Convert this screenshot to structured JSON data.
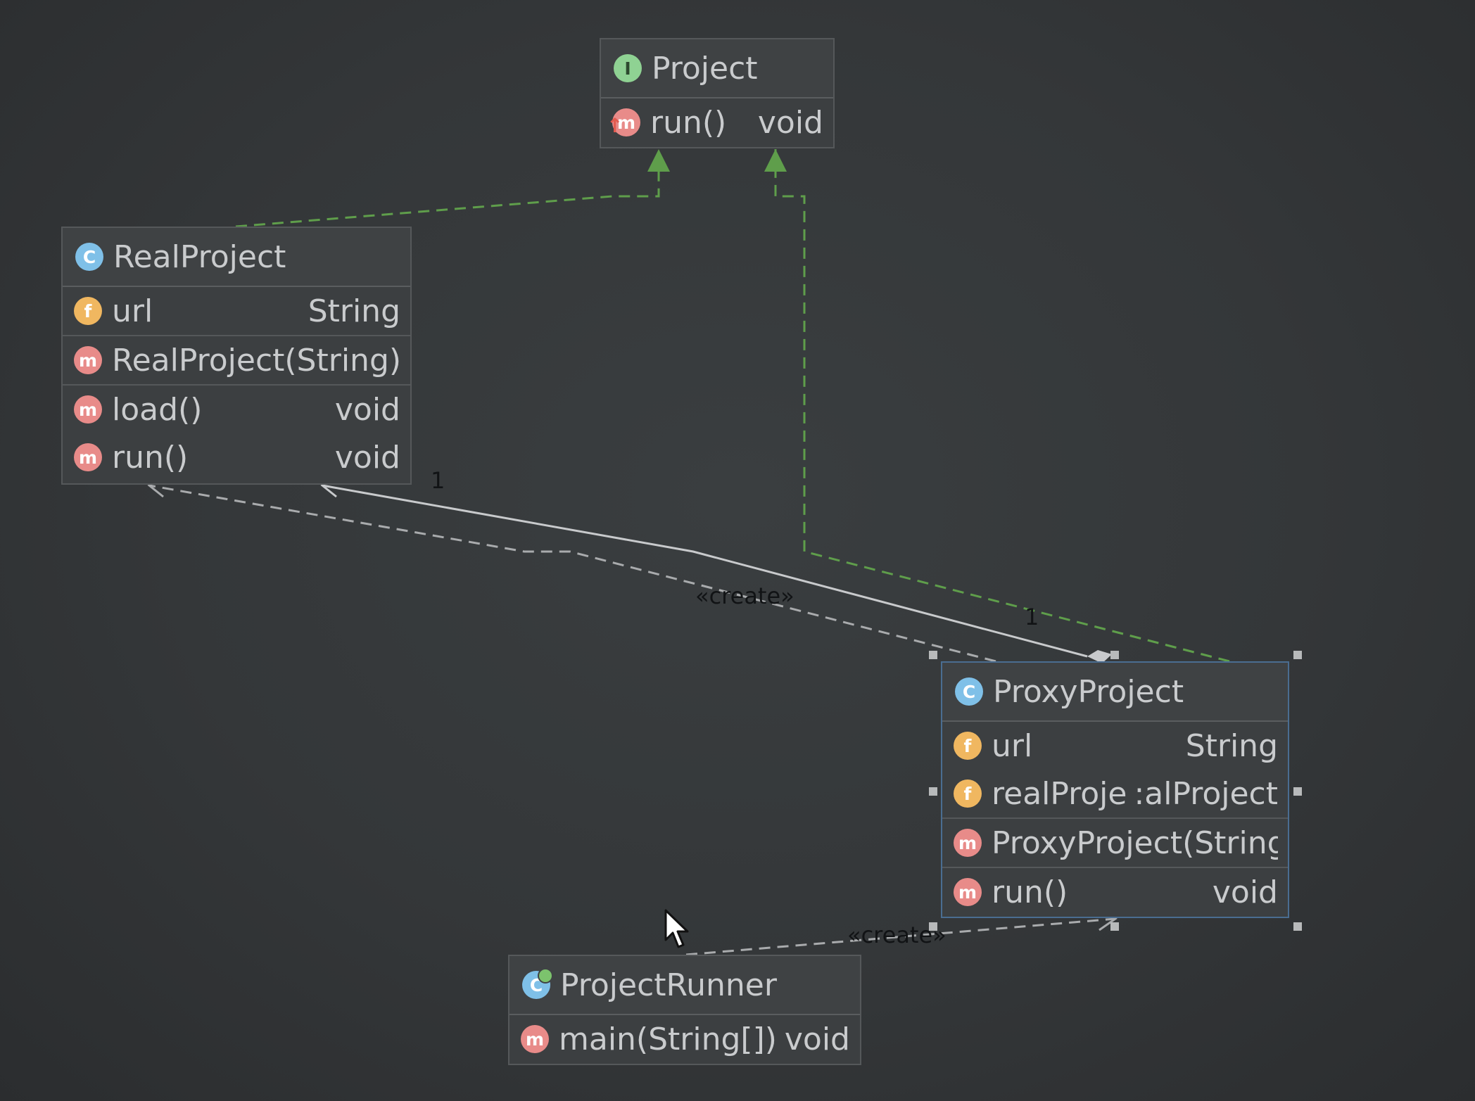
{
  "colors": {
    "realization_edge": "#5f9e4b",
    "dependency_edge": "#a9abad",
    "association_edge": "#c8cacc",
    "selection_border": "#4a6d91"
  },
  "nodes": {
    "project": {
      "kind": "interface",
      "icon": "interface-icon",
      "icon_letter": "I",
      "name": "Project",
      "methods": [
        {
          "name": "run()",
          "type": "void",
          "icon_letter": "m"
        }
      ]
    },
    "real_project": {
      "kind": "class",
      "icon": "class-icon",
      "icon_letter": "C",
      "name": "RealProject",
      "fields": [
        {
          "name": "url",
          "type": "String",
          "icon_letter": "f"
        }
      ],
      "constructors": [
        {
          "name": "RealProject(String)",
          "icon_letter": "m"
        }
      ],
      "methods": [
        {
          "name": "load()",
          "type": "void",
          "icon_letter": "m"
        },
        {
          "name": "run()",
          "type": "void",
          "icon_letter": "m"
        }
      ]
    },
    "proxy_project": {
      "kind": "class",
      "icon": "class-icon",
      "icon_letter": "C",
      "name": "ProxyProject",
      "fields": [
        {
          "name": "url",
          "type": "String",
          "icon_letter": "f"
        },
        {
          "name": "realProject",
          "type": "RealProject",
          "visible_type": ":alProject",
          "icon_letter": "f"
        }
      ],
      "constructors": [
        {
          "name": "ProxyProject(String)",
          "icon_letter": "m"
        }
      ],
      "methods": [
        {
          "name": "run()",
          "type": "void",
          "icon_letter": "m"
        }
      ]
    },
    "project_runner": {
      "kind": "class",
      "icon": "runnable-class-icon",
      "icon_letter": "C",
      "name": "ProjectRunner",
      "methods": [
        {
          "name": "main(String[])",
          "type": "void",
          "icon_letter": "m"
        }
      ]
    }
  },
  "edges": [
    {
      "from": "RealProject",
      "to": "Project",
      "kind": "realization"
    },
    {
      "from": "ProxyProject",
      "to": "Project",
      "kind": "realization"
    },
    {
      "from": "ProxyProject",
      "to": "RealProject",
      "kind": "association",
      "multiplicity_source": "1",
      "multiplicity_target": "1"
    },
    {
      "from": "ProxyProject",
      "to": "RealProject",
      "kind": "dependency",
      "label": "«create»"
    },
    {
      "from": "ProjectRunner",
      "to": "ProxyProject",
      "kind": "dependency",
      "label": "«create»"
    }
  ],
  "labels": {
    "multiplicity_real": "1",
    "multiplicity_proxy": "1",
    "create_real": "«create»",
    "create_proxy": "«create»"
  }
}
